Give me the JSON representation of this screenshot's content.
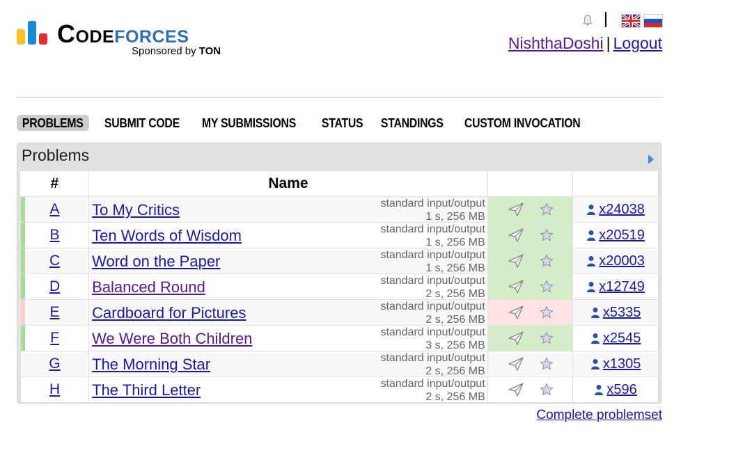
{
  "header": {
    "logo_word_1": "Code",
    "logo_word_2": "forces",
    "sponsor_prefix": "Sponsored by",
    "sponsor_name": "TON",
    "username": "NishthaDoshi",
    "separator": "|",
    "logout": "Logout"
  },
  "nav": [
    "PROBLEMS",
    "SUBMIT CODE",
    "MY SUBMISSIONS",
    "STATUS",
    "STANDINGS",
    "CUSTOM INVOCATION"
  ],
  "box": {
    "title": "Problems"
  },
  "table": {
    "headers": [
      "#",
      "Name",
      "",
      ""
    ],
    "rows": [
      {
        "index": "A",
        "name": "To My Critics",
        "io": "standard input/output",
        "limits": "1 s, 256 MB",
        "solved": "x24038",
        "status": "ok",
        "visited": false
      },
      {
        "index": "B",
        "name": "Ten Words of Wisdom",
        "io": "standard input/output",
        "limits": "1 s, 256 MB",
        "solved": "x20519",
        "status": "ok",
        "visited": false
      },
      {
        "index": "C",
        "name": "Word on the Paper",
        "io": "standard input/output",
        "limits": "1 s, 256 MB",
        "solved": "x20003",
        "status": "ok",
        "visited": false
      },
      {
        "index": "D",
        "name": "Balanced Round",
        "io": "standard input/output",
        "limits": "2 s, 256 MB",
        "solved": "x12749",
        "status": "ok",
        "visited": true
      },
      {
        "index": "E",
        "name": "Cardboard for Pictures",
        "io": "standard input/output",
        "limits": "2 s, 256 MB",
        "solved": "x5335",
        "status": "rej",
        "visited": false
      },
      {
        "index": "F",
        "name": "We Were Both Children",
        "io": "standard input/output",
        "limits": "3 s, 256 MB",
        "solved": "x2545",
        "status": "ok",
        "visited": true
      },
      {
        "index": "G",
        "name": "The Morning Star",
        "io": "standard input/output",
        "limits": "2 s, 256 MB",
        "solved": "x1305",
        "status": "none",
        "visited": false
      },
      {
        "index": "H",
        "name": "The Third Letter",
        "io": "standard input/output",
        "limits": "2 s, 256 MB",
        "solved": "x596",
        "status": "none",
        "visited": false
      }
    ]
  },
  "footer": {
    "complete_link": "Complete problemset"
  },
  "colors": {
    "accepted_marker": "#a8dd98",
    "rejected_marker": "#ffcccc",
    "accepted_bg": "#d4edc9",
    "rejected_bg": "#ffe3e3",
    "link": "#1a1aa6",
    "visited_link": "#551a8b"
  }
}
